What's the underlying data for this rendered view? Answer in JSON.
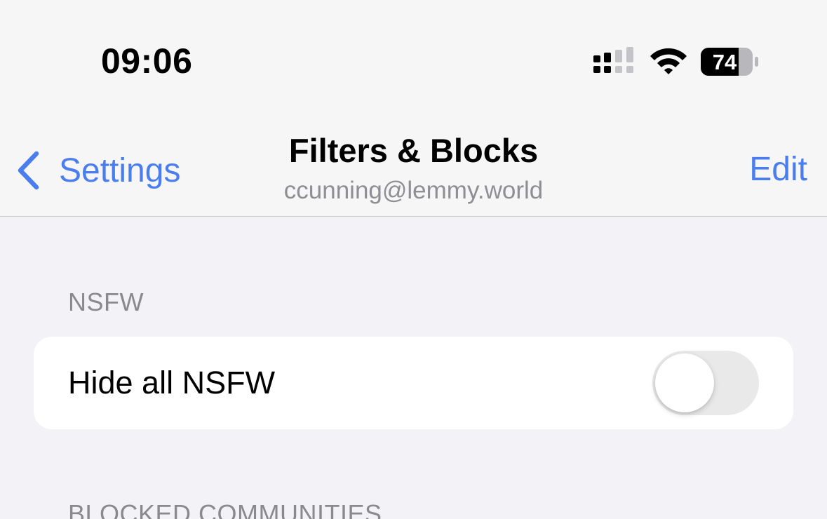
{
  "status_bar": {
    "time": "09:06",
    "battery_level": "74"
  },
  "nav": {
    "back_label": "Settings",
    "title": "Filters & Blocks",
    "subtitle": "ccunning@lemmy.world",
    "edit_label": "Edit"
  },
  "sections": {
    "nsfw": {
      "header": "NSFW",
      "rows": [
        {
          "label": "Hide all NSFW",
          "toggle_on": false
        }
      ]
    },
    "blocked_communities": {
      "header": "BLOCKED COMMUNITIES"
    }
  },
  "colors": {
    "accent": "#4a7ded",
    "background": "#f2f2f7",
    "toggle_off": "#e9e9ea",
    "secondary_text": "#8e8e93"
  }
}
